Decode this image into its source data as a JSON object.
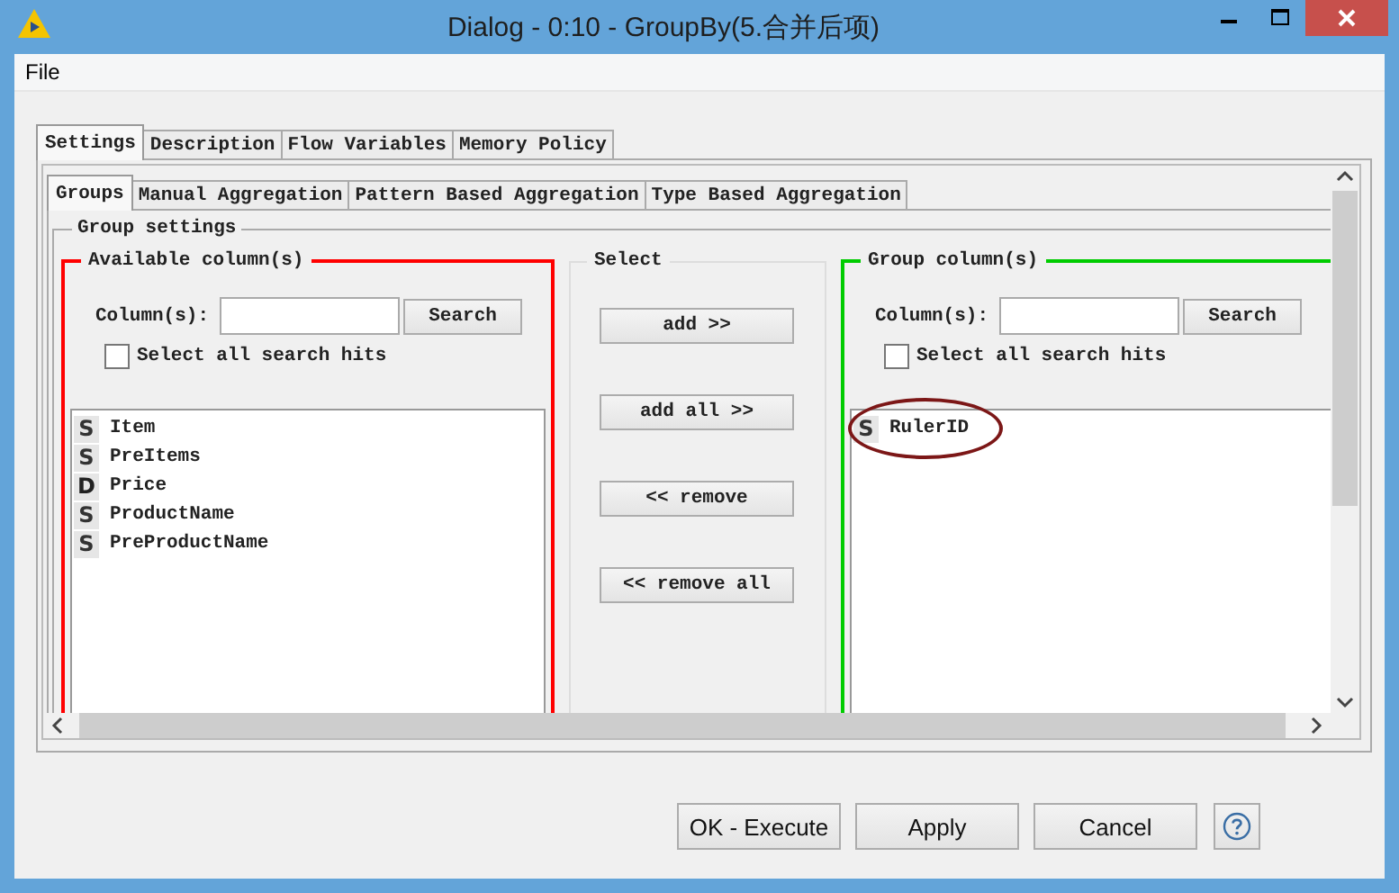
{
  "window": {
    "title": "Dialog - 0:10 - GroupBy(5.合并后项)"
  },
  "menu": [
    "File"
  ],
  "tabs": [
    {
      "label": "Settings",
      "selected": true
    },
    {
      "label": "Description",
      "selected": false
    },
    {
      "label": "Flow Variables",
      "selected": false
    },
    {
      "label": "Memory Policy",
      "selected": false
    }
  ],
  "subtabs": [
    {
      "label": "Groups",
      "selected": true
    },
    {
      "label": "Manual Aggregation",
      "selected": false
    },
    {
      "label": "Pattern Based Aggregation",
      "selected": false
    },
    {
      "label": "Type Based Aggregation",
      "selected": false
    }
  ],
  "group_settings": {
    "title": "Group settings",
    "available": {
      "title": "Available column(s)",
      "search_label": "Column(s):",
      "search_button": "Search",
      "select_all": {
        "label": "Select all search hits",
        "checked": false
      },
      "columns": [
        {
          "type": "S",
          "name": "Item",
          "circled": false
        },
        {
          "type": "S",
          "name": "PreItems",
          "circled": false
        },
        {
          "type": "D",
          "name": "Price",
          "circled": false
        },
        {
          "type": "S",
          "name": "ProductName",
          "circled": false
        },
        {
          "type": "S",
          "name": "PreProductName",
          "circled": false
        }
      ]
    },
    "select": {
      "title": "Select",
      "buttons": [
        "add >>",
        "add all >>",
        "<< remove",
        "<< remove all"
      ]
    },
    "group": {
      "title": "Group column(s)",
      "search_label": "Column(s):",
      "search_button": "Search",
      "select_all": {
        "label": "Select all search hits",
        "checked": false
      },
      "columns": [
        {
          "type": "S",
          "name": "RulerID",
          "circled": true
        }
      ]
    }
  },
  "buttons": [
    "OK - Execute",
    "Apply",
    "Cancel"
  ]
}
